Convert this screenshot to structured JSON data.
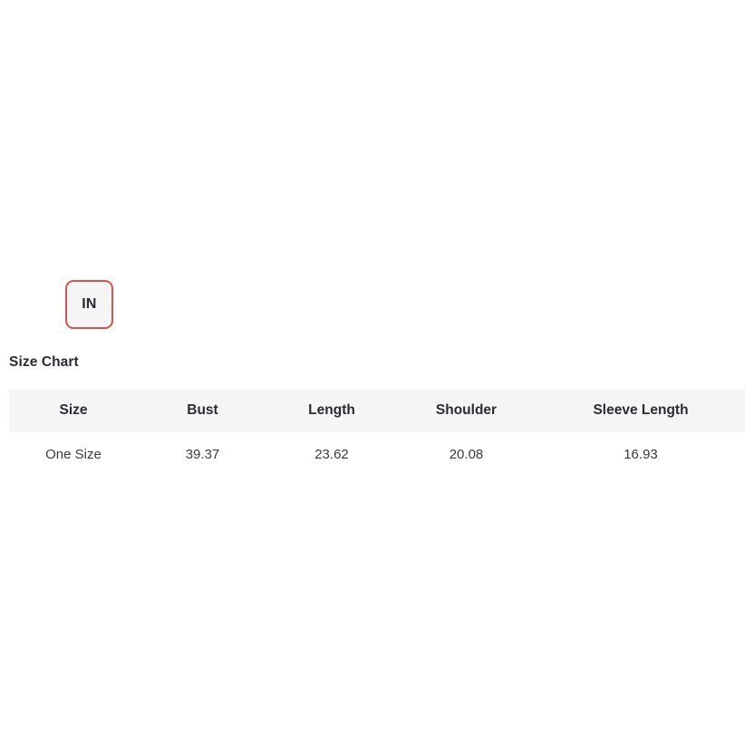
{
  "unit_toggle": {
    "label": "IN",
    "active": true,
    "border_color": "#d9534f",
    "fill_color": "#f5f5f5",
    "text_color": "#2b2b33"
  },
  "size_chart": {
    "title": "Size Chart",
    "header_background": "#f5f5f6",
    "columns": [
      "Size",
      "Bust",
      "Length",
      "Shoulder",
      "Sleeve Length"
    ],
    "rows": [
      {
        "size": "One Size",
        "bust": "39.37",
        "length": "23.62",
        "shoulder": "20.08",
        "sleeve_length": "16.93"
      }
    ]
  }
}
